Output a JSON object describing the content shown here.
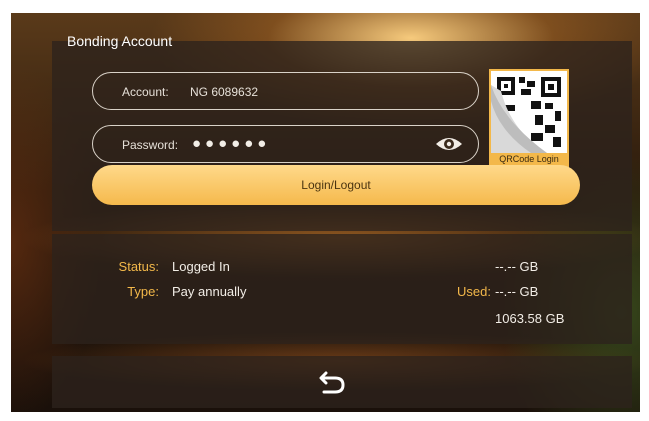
{
  "header": {
    "title": "Bonding Account"
  },
  "form": {
    "account_label": "Account:",
    "account_value": "NG 6089632",
    "password_label": "Password:",
    "password_mask": "●●●●●●",
    "login_button": "Login/Logout",
    "qr_label": "QRCode Login"
  },
  "status": {
    "status_label": "Status:",
    "status_value": "Logged In",
    "type_label": "Type:",
    "type_value": "Pay annually",
    "total": "--.-- GB",
    "used_label": "Used:",
    "used_value": "--.-- GB",
    "remaining": "1063.58 GB"
  },
  "icons": {
    "eye": "eye-icon",
    "qr": "qr-code-icon",
    "back": "back-arrow-icon"
  },
  "colors": {
    "accent": "#f3b84a",
    "button": "#f5b94c"
  }
}
